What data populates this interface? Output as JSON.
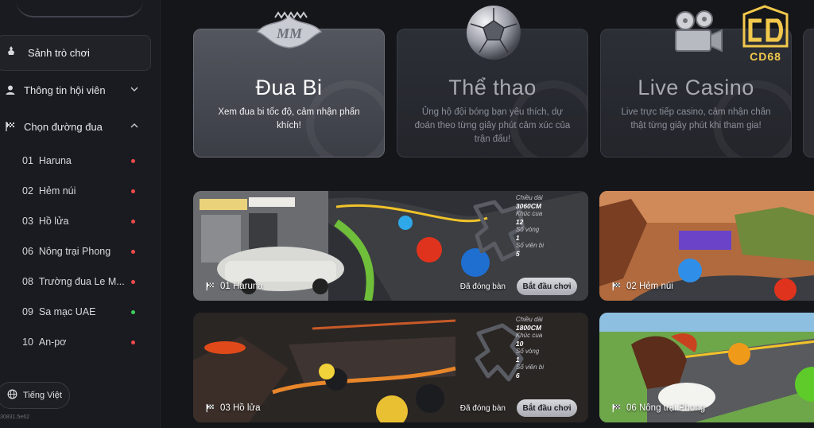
{
  "sidebar": {
    "main_item": {
      "label": "Sảnh trò chơi",
      "icon": "pawn-icon"
    },
    "member_info": {
      "label": "Thông tin hội viên",
      "icon": "user-icon"
    },
    "tracks_section": {
      "label": "Chọn đường đua",
      "icon": "checkered-flag-icon"
    },
    "tracks": [
      {
        "num": "01",
        "label": "Haruna",
        "status_color": "#ef4a4a"
      },
      {
        "num": "02",
        "label": "Hẻm núi",
        "status_color": "#ef4a4a"
      },
      {
        "num": "03",
        "label": "Hồ lửa",
        "status_color": "#ef4a4a"
      },
      {
        "num": "06",
        "label": "Nông trại Phong",
        "status_color": "#ef4a4a"
      },
      {
        "num": "08",
        "label": "Trường đua Le M...",
        "status_color": "#ef4a4a"
      },
      {
        "num": "09",
        "label": "Sa mạc UAE",
        "status_color": "#3fcf5a"
      },
      {
        "num": "10",
        "label": "An-pơ",
        "status_color": "#ef4a4a"
      }
    ],
    "language": {
      "label": "Tiếng Việt",
      "icon": "globe-icon"
    },
    "version": "30831.5e62"
  },
  "categories": [
    {
      "title": "Đua Bi",
      "desc": "Xem đua bi tốc độ, cảm nhận phấn khích!",
      "icon": "mm-crest-icon"
    },
    {
      "title": "Thể thao",
      "desc": "Ủng hộ đội bóng bạn yêu thích, dự đoán theo từng giây phút cảm xúc của trận đấu!",
      "icon": "soccer-ball-icon"
    },
    {
      "title": "Live Casino",
      "desc": "Live trực tiếp casino, cảm nhận chân thật từng giây phút khi tham gia!",
      "icon": "film-camera-icon"
    }
  ],
  "logo": {
    "text": "CD68"
  },
  "races": [
    {
      "name": "01 Haruna",
      "status": "Đã đóng bàn",
      "start_label": "Bắt đầu chơi",
      "stats": {
        "length_label": "Chiều dài",
        "length": "3060CM",
        "turns_label": "Khúc cua",
        "turns": "12",
        "laps_label": "Số vòng",
        "laps": "1",
        "balls_label": "Số viên bi",
        "balls": "5"
      }
    },
    {
      "name": "02 Hẻm núi"
    },
    {
      "name": "03 Hồ lửa",
      "status": "Đã đóng bàn",
      "start_label": "Bắt đầu chơi",
      "stats": {
        "length_label": "Chiều dài",
        "length": "1800CM",
        "turns_label": "Khúc cua",
        "turns": "10",
        "laps_label": "Số vòng",
        "laps": "1",
        "balls_label": "Số viên bi",
        "balls": "6"
      }
    },
    {
      "name": "06 Nông trại Phong"
    }
  ],
  "colors": {
    "accent_logo": "#f2c94c",
    "status_closed": "#ef4a4a",
    "status_open": "#3fcf5a"
  }
}
